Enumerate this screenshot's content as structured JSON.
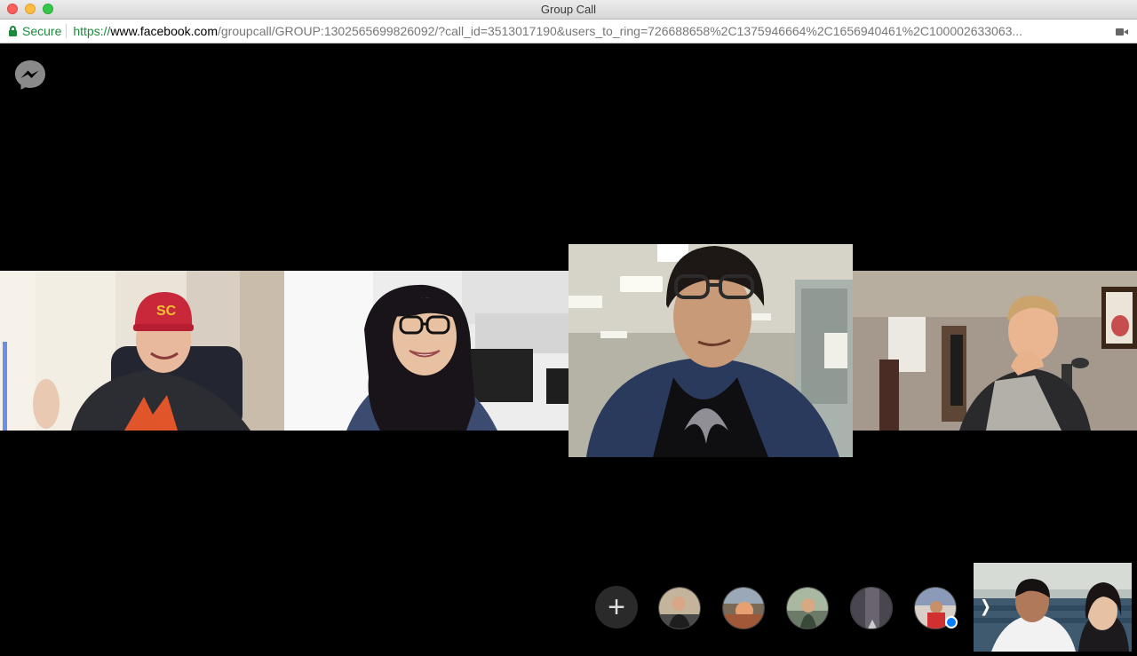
{
  "window": {
    "title": "Group Call"
  },
  "address_bar": {
    "secure_label": "Secure",
    "url_scheme": "https://",
    "url_host": "www.facebook.com",
    "url_path": "/groupcall/GROUP:1302565699826092/?call_id=3513017190&users_to_ring=726688658%2C1375946664%2C1656940461%2C100002633063..."
  },
  "call": {
    "add_participant_label": "+",
    "participants": [
      {
        "id": "p1",
        "hat": "red-cap"
      },
      {
        "id": "p2",
        "glasses": true
      },
      {
        "id": "p3",
        "glasses": true,
        "speaking": true
      },
      {
        "id": "p4"
      }
    ],
    "ringing_avatars": [
      "avatar-1",
      "avatar-2",
      "avatar-3",
      "avatar-4",
      "avatar-5"
    ]
  },
  "colors": {
    "background": "#000000",
    "secure_green": "#1a8a3a",
    "messenger_blue": "#0a7cff"
  },
  "icons": [
    "messenger-icon",
    "lock-icon",
    "camera-icon",
    "add-icon",
    "chevron-left-icon"
  ]
}
